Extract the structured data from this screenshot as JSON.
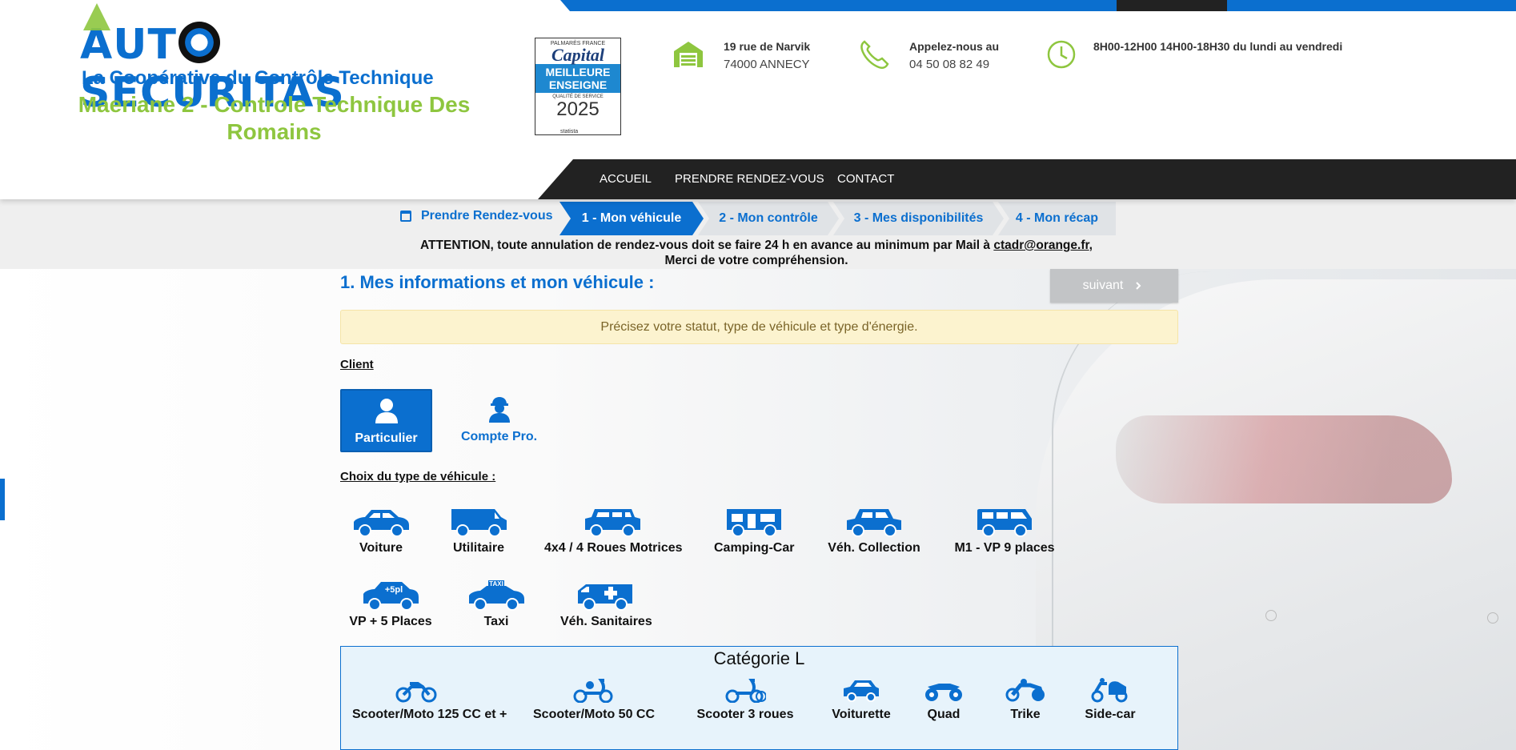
{
  "brand": {
    "logo_pre": "A",
    "logo_post": "UT",
    "logo_rest": "SECURITAS",
    "tagline": "La Coopérative du Contrôle Technique",
    "center_name": "Maeriane 2 - Controle Technique Des Romains",
    "color_primary": "#0b6fcf",
    "color_accent": "#8ec63f"
  },
  "badge": {
    "line1": "PALMARÈS FRANCE",
    "brand": "Capital",
    "main": "MEILLEURE ENSEIGNE",
    "sub": "QUALITÉ DE SERVICE",
    "year": "2025",
    "foot": "statista"
  },
  "contact": {
    "address_title": "19 rue de Narvik",
    "address_city": "74000 ANNECY",
    "phone_title": "Appelez-nous au",
    "phone_number": "04 50 08 82 49",
    "hours": "8H00-12H00 14H00-18H30 du lundi au vendredi"
  },
  "nav": [
    "ACCUEIL",
    "PRENDRE RENDEZ-VOUS",
    "CONTACT"
  ],
  "steps": {
    "first": "Prendre Rendez-vous",
    "items": [
      "1 - Mon véhicule",
      "2 - Mon contrôle",
      "3 - Mes disponibilités",
      "4 - Mon récap"
    ],
    "active_index": 0
  },
  "attention": {
    "text": "ATTENTION, toute annulation de rendez-vous doit se faire 24 h en avance au minimum par Mail à",
    "mail": "ctadr@orange.fr",
    "comma": ",",
    "line2": "Merci de votre compréhension."
  },
  "form": {
    "title": "1. Mes informations et mon véhicule :",
    "next_label": "suivant",
    "alert": "Précisez votre statut, type de véhicule et type d'énergie.",
    "client_label": "Client",
    "client_options": [
      "Particulier",
      "Compte Pro."
    ],
    "client_selected": 0,
    "vehicle_label": "Choix du type de véhicule :",
    "vehicles_row1": [
      "Voiture",
      "Utilitaire",
      "4x4 / 4 Roues Motrices",
      "Camping-Car",
      "Véh. Collection",
      "M1 - VP 9 places"
    ],
    "vehicles_row2": [
      "VP + 5 Places",
      "Taxi",
      "Véh. Sanitaires"
    ],
    "icons_row2": [
      "+5pl",
      "TAXI"
    ]
  },
  "category_l": {
    "title": "Catégorie L",
    "items": [
      "Scooter/Moto 125 CC et +",
      "Scooter/Moto 50 CC",
      "Scooter 3 roues",
      "Voiturette",
      "Quad",
      "Trike",
      "Side-car"
    ]
  }
}
